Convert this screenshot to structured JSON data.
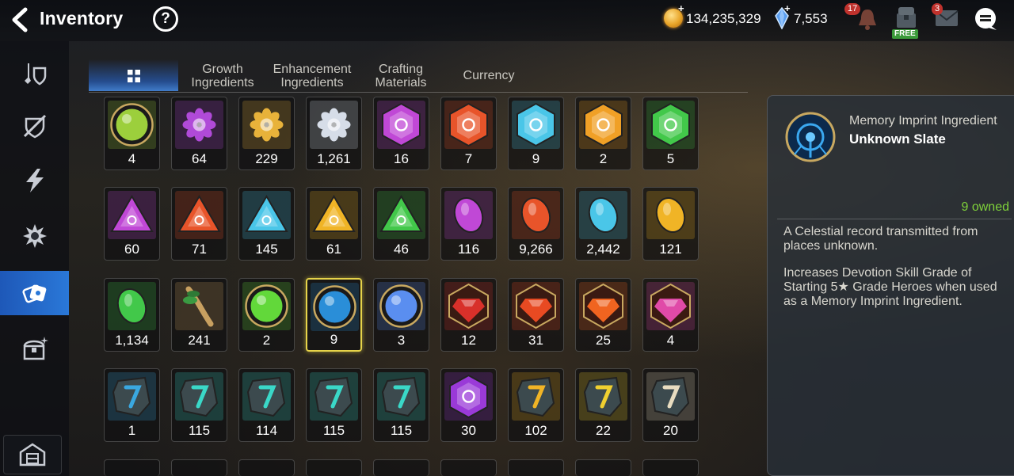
{
  "header": {
    "title": "Inventory",
    "help_label": "?",
    "gold": "134,235,329",
    "crystals": "7,553",
    "notifications_badge": "17",
    "mail_badge": "3",
    "chest_label": "FREE"
  },
  "sidebar": {
    "items": [
      {
        "icon": "equipment-icon"
      },
      {
        "icon": "artifact-icon"
      },
      {
        "icon": "lightning-icon"
      },
      {
        "icon": "splash-material-icon"
      },
      {
        "icon": "materials-icon",
        "active": true
      },
      {
        "icon": "chest-icon"
      }
    ],
    "bottom_icon": "storage-house-icon"
  },
  "tabs": [
    {
      "line1": "",
      "line2": "",
      "icon": "grid-icon",
      "active": true
    },
    {
      "line1": "Growth",
      "line2": "Ingredients"
    },
    {
      "line1": "Enhancement",
      "line2": "Ingredients"
    },
    {
      "line1": "Crafting",
      "line2": "Materials"
    },
    {
      "line1": "Currency",
      "line2": ""
    }
  ],
  "inventory": {
    "rows": [
      [
        {
          "name": "phantasma-icon",
          "count": "4",
          "color": "#9ccf3c",
          "shape": "circle"
        },
        {
          "name": "purple-flower-icon",
          "count": "64",
          "color": "#b04ad8",
          "shape": "flower"
        },
        {
          "name": "gold-flower-icon",
          "count": "229",
          "color": "#e8b23a",
          "shape": "flower"
        },
        {
          "name": "silver-flower-icon",
          "count": "1,261",
          "color": "#d6dde8",
          "shape": "flower"
        },
        {
          "name": "moon-rune-hex-icon",
          "count": "16",
          "color": "#c048d6",
          "shape": "hex"
        },
        {
          "name": "fire-rune-hex-icon",
          "count": "7",
          "color": "#e8542a",
          "shape": "hex"
        },
        {
          "name": "ice-rune-hex-icon",
          "count": "9",
          "color": "#4ac6e8",
          "shape": "hex"
        },
        {
          "name": "light-rune-hex-icon",
          "count": "2",
          "color": "#f0a026",
          "shape": "hex"
        },
        {
          "name": "earth-rune-hex-icon",
          "count": "5",
          "color": "#42c84a",
          "shape": "hex"
        }
      ],
      [
        {
          "name": "moon-rune-triangle-icon",
          "count": "60",
          "color": "#c048d6",
          "shape": "tri"
        },
        {
          "name": "fire-rune-triangle-icon",
          "count": "71",
          "color": "#e8542a",
          "shape": "tri"
        },
        {
          "name": "ice-rune-triangle-icon",
          "count": "145",
          "color": "#4ac6e8",
          "shape": "tri"
        },
        {
          "name": "light-rune-triangle-icon",
          "count": "61",
          "color": "#f0b426",
          "shape": "tri"
        },
        {
          "name": "earth-rune-triangle-icon",
          "count": "46",
          "color": "#42c84a",
          "shape": "tri"
        },
        {
          "name": "moon-rune-oval-icon",
          "count": "116",
          "color": "#c048d6",
          "shape": "oval"
        },
        {
          "name": "fire-rune-oval-icon",
          "count": "9,266",
          "color": "#e8542a",
          "shape": "oval"
        },
        {
          "name": "ice-rune-oval-icon",
          "count": "2,442",
          "color": "#4ac6e8",
          "shape": "oval"
        },
        {
          "name": "light-rune-oval-icon",
          "count": "121",
          "color": "#f0b426",
          "shape": "oval"
        }
      ],
      [
        {
          "name": "earth-rune-oval-icon",
          "count": "1,134",
          "color": "#42c84a",
          "shape": "oval"
        },
        {
          "name": "herb-root-icon",
          "count": "241",
          "color": "#c8a060",
          "shape": "herb"
        },
        {
          "name": "green-orb-icon",
          "count": "2",
          "color": "#62d83a",
          "shape": "circle"
        },
        {
          "name": "unknown-slate-icon",
          "count": "9",
          "color": "#2a8ed8",
          "shape": "circle",
          "selected": true
        },
        {
          "name": "blue-shard-icon",
          "count": "3",
          "color": "#5a8ef0",
          "shape": "circle"
        },
        {
          "name": "red-gem-icon",
          "count": "12",
          "color": "#d8302a",
          "shape": "gem"
        },
        {
          "name": "red-hammer-gem-icon",
          "count": "31",
          "color": "#e84a22",
          "shape": "gem"
        },
        {
          "name": "orange-gem-icon",
          "count": "25",
          "color": "#f06420",
          "shape": "gem"
        },
        {
          "name": "pink-potion-icon",
          "count": "4",
          "color": "#e04aa8",
          "shape": "gem"
        }
      ],
      [
        {
          "name": "blue-stone-tablet-icon",
          "count": "1",
          "color": "#3aa8e0",
          "shape": "stone"
        },
        {
          "name": "stone-rune-1-icon",
          "count": "115",
          "color": "#3ad8c8",
          "shape": "stone"
        },
        {
          "name": "stone-rune-2-icon",
          "count": "114",
          "color": "#3ad8c8",
          "shape": "stone"
        },
        {
          "name": "stone-rune-3-icon",
          "count": "115",
          "color": "#3ad8c8",
          "shape": "stone"
        },
        {
          "name": "stone-rune-4-icon",
          "count": "115",
          "color": "#3ad8c8",
          "shape": "stone"
        },
        {
          "name": "purple-cross-stone-icon",
          "count": "30",
          "color": "#9a3ad8",
          "shape": "hex"
        },
        {
          "name": "gold-hammer-stone-icon",
          "count": "102",
          "color": "#f0b426",
          "shape": "stone"
        },
        {
          "name": "gold-mark-stone-icon",
          "count": "22",
          "color": "#f0d030",
          "shape": "stone"
        },
        {
          "name": "white-slate-icon",
          "count": "20",
          "color": "#e8dcc0",
          "shape": "stone"
        }
      ]
    ]
  },
  "detail": {
    "icon": "unknown-slate-icon",
    "category": "Memory Imprint Ingredient",
    "name": "Unknown Slate",
    "owned": "9 owned",
    "description_1": "A Celestial record transmitted from places unknown.",
    "description_2": "Increases Devotion Skill Grade of Starting 5★ Grade Heroes when used as a Memory Imprint Ingredient."
  }
}
